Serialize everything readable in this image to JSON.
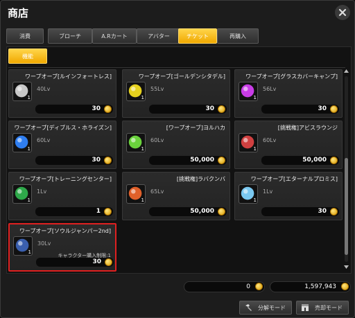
{
  "window": {
    "title": "商店"
  },
  "tabs": [
    {
      "label": "消費"
    },
    {
      "label": "ブローチ"
    },
    {
      "label": "A.Rカート"
    },
    {
      "label": "アバター"
    },
    {
      "label": "チケット"
    },
    {
      "label": "再購入"
    }
  ],
  "subtab": {
    "label": "機能"
  },
  "items": [
    {
      "name": "ワープオーブ[ルインフォートレス]",
      "level": "40Lv",
      "qty": "1",
      "price": "30",
      "icon": "silver-orb-icon",
      "color": "#c8c8c8"
    },
    {
      "name": "ワープオーブ[ゴールデンシタデル]",
      "level": "55Lv",
      "qty": "1",
      "price": "30",
      "icon": "gold-orb-icon",
      "color": "#e6d21e"
    },
    {
      "name": "ワープオーブ[グラスカバーキャンプ]",
      "level": "56Lv",
      "qty": "1",
      "price": "30",
      "icon": "purple-orb-icon",
      "color": "#c83ce6"
    },
    {
      "name": "ワープオーブ[ディブルス・ホライズン]",
      "level": "60Lv",
      "qty": "1",
      "price": "30",
      "icon": "blue-orb-icon",
      "color": "#2f7ef0"
    },
    {
      "name": "[ワープオーブ]ヨルハカ",
      "level": "60Lv",
      "qty": "1",
      "price": "50,000",
      "icon": "green-gate-icon",
      "color": "#6ad23c"
    },
    {
      "name": "[挑戦権]アビスラウンジ",
      "level": "60Lv",
      "qty": "1",
      "price": "50,000",
      "icon": "red-book-icon",
      "color": "#d04040"
    },
    {
      "name": "ワープオーブ[トレーニングセンター]",
      "level": "1Lv",
      "qty": "1",
      "price": "1",
      "icon": "green-card-icon",
      "color": "#2ea84a"
    },
    {
      "name": "[挑戦権]ラバクンバ",
      "level": "65Lv",
      "qty": "1",
      "price": "50,000",
      "icon": "fire-gate-icon",
      "color": "#e0602a"
    },
    {
      "name": "ワープオーブ[エターナルプロミス]",
      "level": "1Lv",
      "qty": "1",
      "price": "30",
      "icon": "crystal-orb-icon",
      "color": "#7ac8f0"
    },
    {
      "name": "ワープオーブ[ソウルジャンパー2nd]",
      "level": "30Lv",
      "qty": "1",
      "price": "30",
      "limit": "キャラクター購入制限:1",
      "icon": "soul-orb-icon",
      "color": "#3a5fae"
    }
  ],
  "footer": {
    "total_cost": "0",
    "balance": "1,597,943",
    "disassemble_label": "分解モード",
    "sell_label": "売却モード"
  }
}
